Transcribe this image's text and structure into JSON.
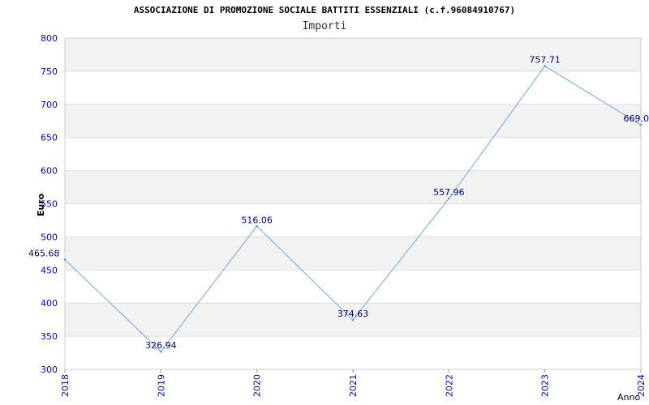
{
  "chart_data": {
    "type": "line",
    "title": "ASSOCIAZIONE DI PROMOZIONE SOCIALE BATTITI ESSENZIALI (c.f.96084910767)",
    "subtitle": "Importi",
    "xlabel": "Anno",
    "ylabel": "Euro",
    "categories": [
      "2018",
      "2019",
      "2020",
      "2021",
      "2022",
      "2023",
      "2024"
    ],
    "series": [
      {
        "values": [
          465.68,
          326.94,
          516.06,
          374.63,
          557.96,
          757.71,
          669.0
        ]
      }
    ],
    "data_labels": [
      "465.68",
      "326.94",
      "516.06",
      "374.63",
      "557.96",
      "757.71",
      "669.0"
    ],
    "yticks": [
      300,
      350,
      400,
      450,
      500,
      550,
      600,
      650,
      700,
      750,
      800
    ],
    "ylim": [
      300,
      800
    ],
    "grid": true,
    "colors": {
      "line": "#6fa8dc",
      "band": "#f2f2f2",
      "tick": "#0000cc",
      "data_label": "#000080"
    }
  }
}
